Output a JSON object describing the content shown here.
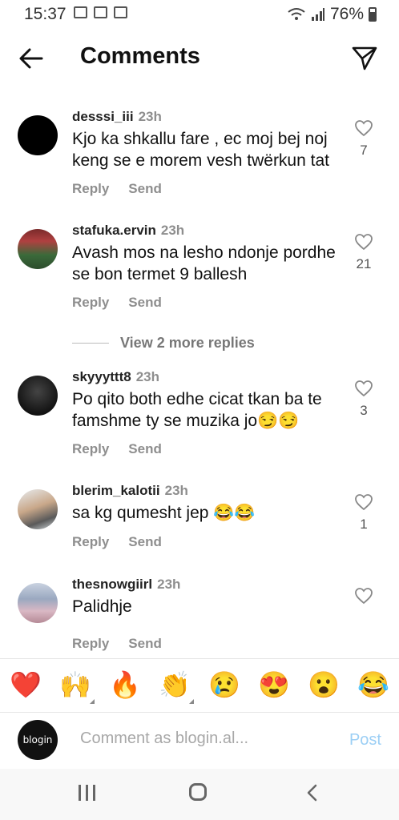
{
  "status_bar": {
    "time": "15:37",
    "battery": "76%"
  },
  "header": {
    "title": "Comments"
  },
  "comments": [
    {
      "username": "desssi_iii",
      "time": "23h",
      "text": "Kjo ka shkallu fare , ec moj bej noj keng  se e morem vesh twërkun tat",
      "reply_label": "Reply",
      "send_label": "Send",
      "likes": "7"
    },
    {
      "username": "stafuka.ervin",
      "time": "23h",
      "text": "Avash mos na lesho ndonje pordhe se bon termet 9 ballesh",
      "reply_label": "Reply",
      "send_label": "Send",
      "likes": "21"
    },
    {
      "username": "skyyyttt8",
      "time": "23h",
      "text": "Po qito both edhe cicat tkan ba te famshme ty se muzika jo😏😏",
      "reply_label": "Reply",
      "send_label": "Send",
      "likes": "3"
    },
    {
      "username": "blerim_kalotii",
      "time": "23h",
      "text": "sa kg qumesht jep 😂😂",
      "reply_label": "Reply",
      "send_label": "Send",
      "likes": "1"
    },
    {
      "username": "thesnowgiirl",
      "time": "23h",
      "text": "Palidhje",
      "reply_label": "Reply",
      "send_label": "Send",
      "likes": ""
    }
  ],
  "view_more_replies": "View 2 more replies",
  "emoji_bar": [
    "❤️",
    "🙌",
    "🔥",
    "👏",
    "😢",
    "😍",
    "😮",
    "😂"
  ],
  "composer": {
    "avatar_text": "blogin",
    "placeholder": "Comment as blogin.al...",
    "post_label": "Post"
  },
  "colors": {
    "post_disabled": "#9ccff5",
    "meta_gray": "#8e8e8e"
  }
}
